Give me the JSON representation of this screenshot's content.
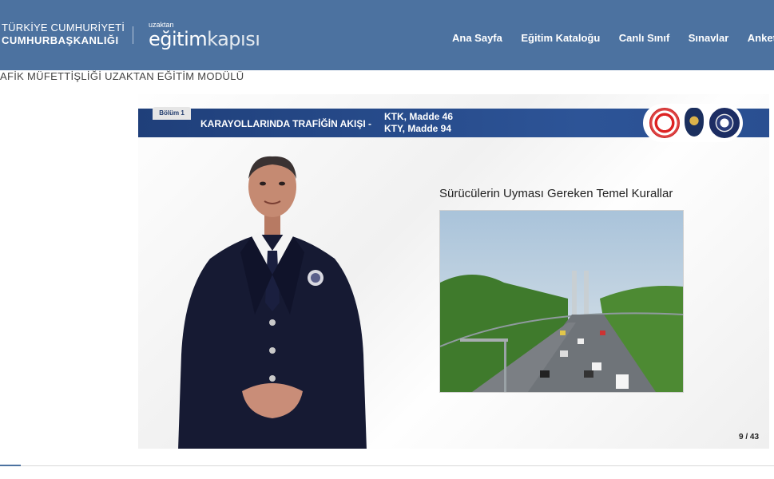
{
  "header": {
    "org_line1": "TÜRKİYE CUMHURİYETİ",
    "org_line2": "CUMHURBAŞKANLIĞI",
    "logo_small": "uzaktan",
    "logo_big_a": "eğitim",
    "logo_big_b": "kapısı",
    "nav": [
      "Ana Sayfa",
      "Eğitim Kataloğu",
      "Canlı Sınıf",
      "Sınavlar",
      "Anketl"
    ]
  },
  "breadcrumb": "AFİK MÜFETTİŞLİĞİ UZAKTAN EĞİTİM MODÜLÜ",
  "slide": {
    "chapter": "Bölüm 1",
    "title": "KARAYOLLARINDA TRAFİĞİN AKIŞI -",
    "ref_line1": "KTK, Madde 46",
    "ref_line2": "KTY, Madde 94",
    "heading": "Sürücülerin Uyması Gereken Temel Kurallar",
    "page": "9 / 43"
  },
  "colors": {
    "header_bg": "#4c72a0",
    "banner_bg": "#2d5497"
  }
}
